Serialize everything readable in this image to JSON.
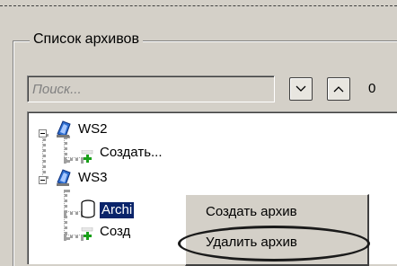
{
  "group": {
    "title": "Список архивов"
  },
  "search": {
    "placeholder": "Поиск...",
    "value": ""
  },
  "nav": {
    "down_icon": "chevron-down-icon",
    "up_icon": "chevron-up-icon",
    "count": "0"
  },
  "tree": {
    "nodes": [
      {
        "label": "WS2",
        "icon": "computer-icon",
        "expanded": true
      },
      {
        "label": "Создать...",
        "icon": "add-icon"
      },
      {
        "label": "WS3",
        "icon": "computer-icon",
        "expanded": true
      },
      {
        "label": "Archi",
        "icon": "database-icon",
        "selected": true
      },
      {
        "label": "Созд",
        "icon": "add-icon"
      }
    ]
  },
  "context_menu": {
    "items": [
      {
        "label": "Создать архив"
      },
      {
        "label": "Удалить архив",
        "highlighted": true
      }
    ]
  },
  "colors": {
    "selection": "#0a246a",
    "add_icon": "#19a019",
    "window_bg": "#d4d0c8"
  }
}
